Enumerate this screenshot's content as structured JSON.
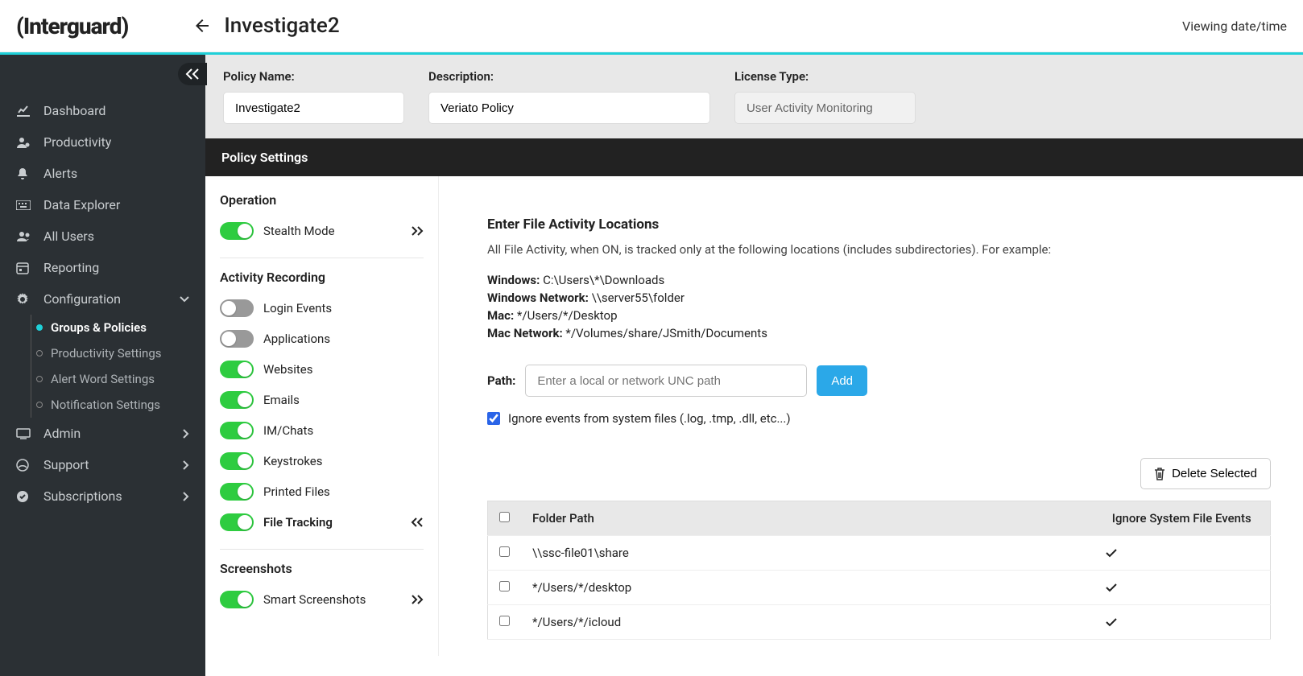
{
  "brand": "(Interguard)",
  "page_title": "Investigate2",
  "viewing_label": "Viewing date/time",
  "sidebar": {
    "items": [
      {
        "label": "Dashboard",
        "icon": "chart"
      },
      {
        "label": "Productivity",
        "icon": "user-dot"
      },
      {
        "label": "Alerts",
        "icon": "bell"
      },
      {
        "label": "Data Explorer",
        "icon": "keyboard"
      },
      {
        "label": "All Users",
        "icon": "users"
      },
      {
        "label": "Reporting",
        "icon": "calendar"
      },
      {
        "label": "Configuration",
        "icon": "gear",
        "expanded": true
      },
      {
        "label": "Admin",
        "icon": "admin",
        "chev": true
      },
      {
        "label": "Support",
        "icon": "support",
        "chev": true
      },
      {
        "label": "Subscriptions",
        "icon": "check-circle",
        "chev": true
      }
    ],
    "config_sub": [
      {
        "label": "Groups & Policies",
        "active": true
      },
      {
        "label": "Productivity Settings"
      },
      {
        "label": "Alert Word Settings"
      },
      {
        "label": "Notification Settings"
      }
    ]
  },
  "policy": {
    "name_label": "Policy Name:",
    "name_value": "Investigate2",
    "desc_label": "Description:",
    "desc_value": "Veriato Policy",
    "license_label": "License Type:",
    "license_value": "User Activity Monitoring"
  },
  "settings_title": "Policy Settings",
  "operation": {
    "title": "Operation",
    "stealth": "Stealth Mode"
  },
  "activity": {
    "title": "Activity Recording",
    "items": [
      {
        "label": "Login Events",
        "on": false
      },
      {
        "label": "Applications",
        "on": false
      },
      {
        "label": "Websites",
        "on": true
      },
      {
        "label": "Emails",
        "on": true
      },
      {
        "label": "IM/Chats",
        "on": true
      },
      {
        "label": "Keystrokes",
        "on": true
      },
      {
        "label": "Printed Files",
        "on": true
      },
      {
        "label": "File Tracking",
        "on": true,
        "bold": true,
        "collapse": true
      }
    ]
  },
  "screenshots": {
    "title": "Screenshots",
    "smart": "Smart Screenshots"
  },
  "file_activity": {
    "title": "Enter File Activity Locations",
    "desc": "All File Activity, when ON, is tracked only at the following locations (includes subdirectories). For example:",
    "examples": [
      {
        "k": "Windows:",
        "v": "C:\\Users\\*\\Downloads"
      },
      {
        "k": "Windows Network:",
        "v": "\\\\server55\\folder"
      },
      {
        "k": "Mac:",
        "v": "*/Users/*/Desktop"
      },
      {
        "k": "Mac Network:",
        "v": "*/Volumes/share/JSmith/Documents"
      }
    ],
    "path_label": "Path:",
    "path_placeholder": "Enter a local or network UNC path",
    "add_label": "Add",
    "ignore_label": "Ignore events from system files (.log, .tmp, .dll, etc...)",
    "delete_label": "Delete Selected",
    "table": {
      "col_path": "Folder Path",
      "col_ignore": "Ignore System File Events",
      "rows": [
        {
          "path": "\\\\ssc-file01\\share",
          "ignore": true
        },
        {
          "path": "*/Users/*/desktop",
          "ignore": true
        },
        {
          "path": "*/Users/*/icloud",
          "ignore": true
        }
      ]
    }
  }
}
